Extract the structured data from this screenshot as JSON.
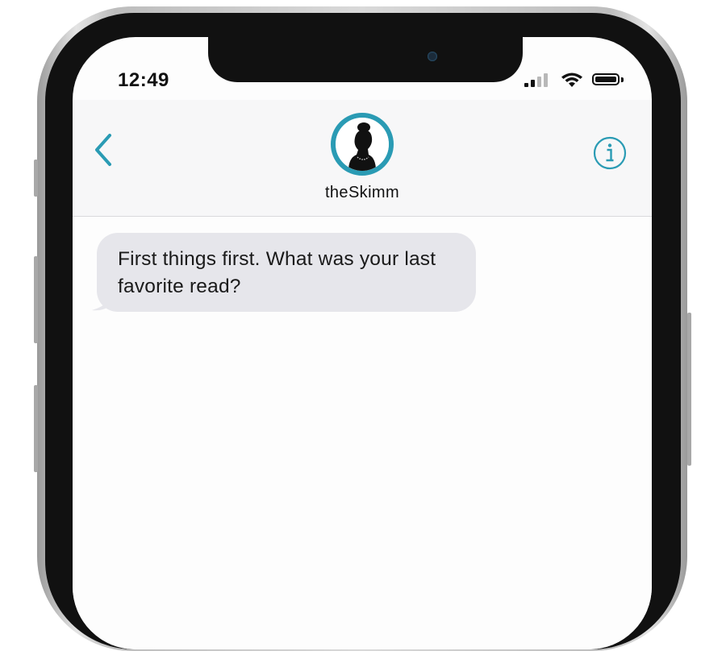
{
  "status_bar": {
    "time": "12:49",
    "icons": [
      "signal-icon",
      "wifi-icon",
      "battery-icon"
    ]
  },
  "conversation_header": {
    "contact_name": "theSkimm",
    "back_icon": "chevron-left-icon",
    "info_icon": "info-icon",
    "accent_color": "#2a9bb4"
  },
  "messages": [
    {
      "sender": "theSkimm",
      "direction": "incoming",
      "text": "First things first. What was your last favorite read?"
    }
  ],
  "colors": {
    "incoming_bubble": "#e6e6eb",
    "header_background": "#f7f7f8"
  }
}
